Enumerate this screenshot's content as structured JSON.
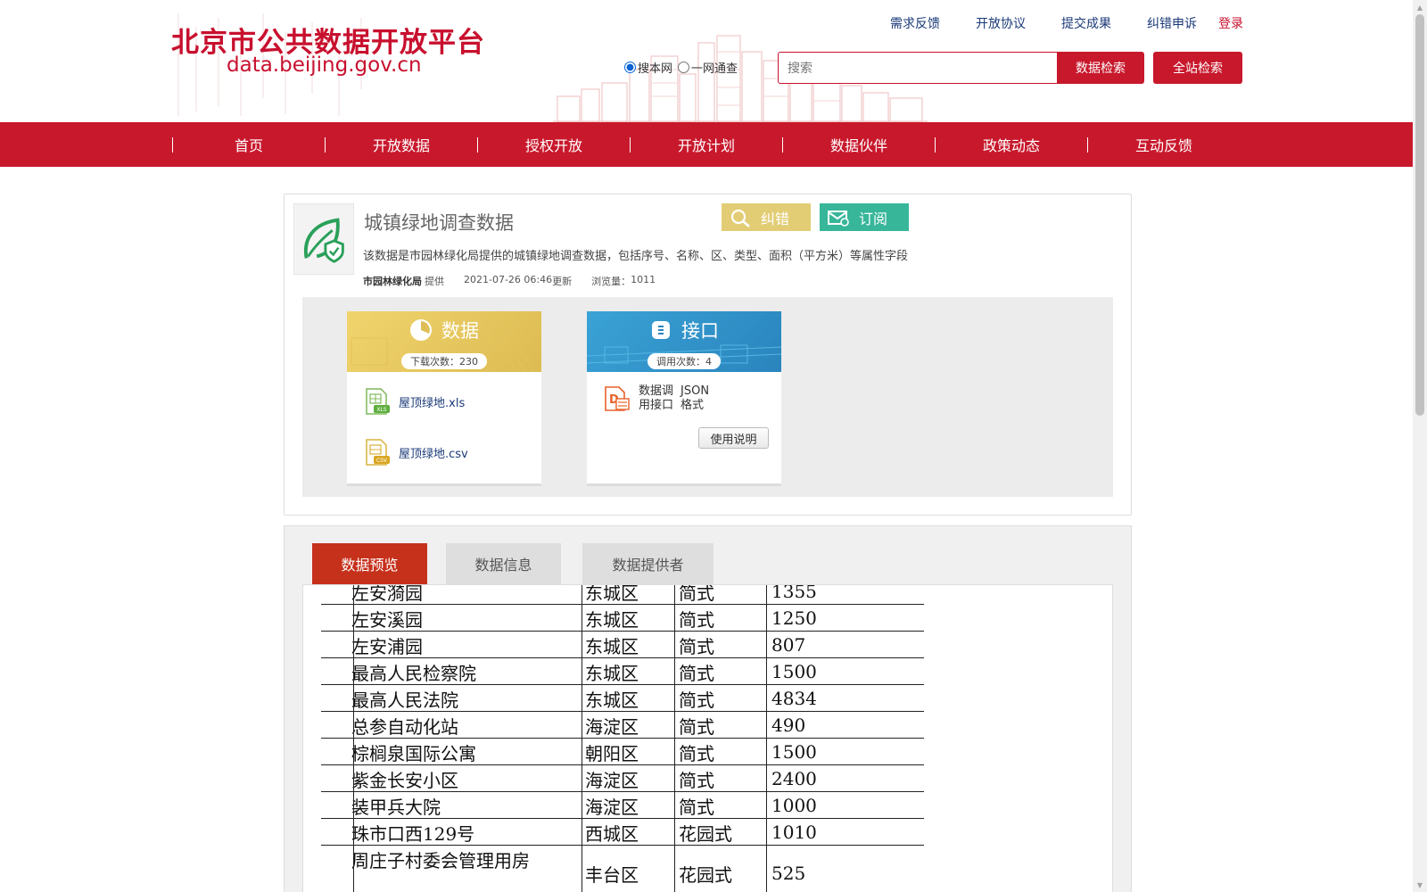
{
  "site": {
    "title": "北京市公共数据开放平台",
    "url": "data.beijing.gov.cn"
  },
  "toplinks": [
    {
      "label": "需求反馈"
    },
    {
      "label": "开放协议"
    },
    {
      "label": "提交成果"
    },
    {
      "label": "纠错申诉"
    },
    {
      "label": "登录"
    }
  ],
  "search": {
    "scope_options": [
      {
        "label": "搜本网",
        "checked": true
      },
      {
        "label": "一网通查",
        "checked": false
      }
    ],
    "placeholder": "搜索",
    "button_label": "数据检索",
    "site_button_label": "全站检索"
  },
  "nav": {
    "items": [
      "首页",
      "开放数据",
      "授权开放",
      "开放计划",
      "数据伙伴",
      "政策动态",
      "互动反馈"
    ]
  },
  "dataset": {
    "title": "城镇绿地调查数据",
    "correct_label": "纠错",
    "subscribe_label": "订阅",
    "description": "该数据是市园林绿化局提供的城镇绿地调查数据，包括序号、名称、区、类型、面积（平方米）等属性字段",
    "provider": "市园林绿化局",
    "provider_suffix": "提供",
    "updated": "2021-07-26 06:46",
    "updated_suffix": "更新",
    "views_label": "浏览量：",
    "views": "1011"
  },
  "data_panel": {
    "title": "数据",
    "count_label": "下载次数：230",
    "files": [
      {
        "name": "屋顶绿地.xls",
        "icon": "xls-file-icon"
      },
      {
        "name": "屋顶绿地.csv",
        "icon": "csv-file-icon"
      }
    ]
  },
  "api_panel": {
    "title": "接口",
    "count_label": "调用次数：4",
    "col1_line1": "数据调",
    "col1_line2": "用接口",
    "col2_line1": "JSON",
    "col2_line2": "格式",
    "doc_button": "使用说明"
  },
  "tabs": [
    {
      "label": "数据预览",
      "active": true
    },
    {
      "label": "数据信息",
      "active": false
    },
    {
      "label": "数据提供者",
      "active": false
    }
  ],
  "preview_rows": [
    [
      "左安漪园",
      "东城区",
      "简式",
      "1355"
    ],
    [
      "左安溪园",
      "东城区",
      "简式",
      "1250"
    ],
    [
      "左安浦园",
      "东城区",
      "简式",
      "807"
    ],
    [
      "最高人民检察院",
      "东城区",
      "简式",
      "1500"
    ],
    [
      "最高人民法院",
      "东城区",
      "简式",
      "4834"
    ],
    [
      "总参自动化站",
      "海淀区",
      "简式",
      "490"
    ],
    [
      "棕榈泉国际公寓",
      "朝阳区",
      "简式",
      "1500"
    ],
    [
      "紫金长安小区",
      "海淀区",
      "简式",
      "2400"
    ],
    [
      "装甲兵大院",
      "海淀区",
      "简式",
      "1000"
    ],
    [
      "珠市口西129号",
      "西城区",
      "花园式",
      "1010"
    ],
    [
      "周庄子村委会管理用房",
      "丰台区",
      "花园式",
      "525"
    ]
  ],
  "colors": {
    "brand_red": "#c8182c",
    "tab_active": "#c6311c",
    "correct_yellow": "#e2cd75",
    "subscribe_green": "#37b69a",
    "link_blue": "#1a3a78"
  }
}
